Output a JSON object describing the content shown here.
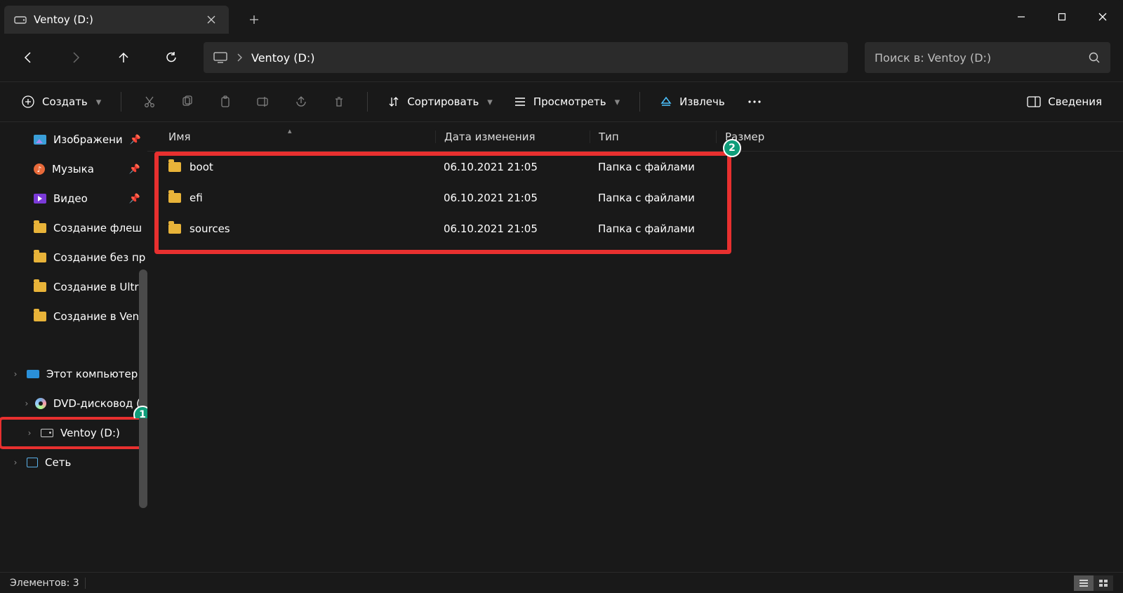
{
  "window": {
    "tab_title": "Ventoy (D:)"
  },
  "address": {
    "location": "Ventoy (D:)"
  },
  "search": {
    "placeholder": "Поиск в: Ventoy (D:)"
  },
  "toolbar": {
    "create": "Создать",
    "sort": "Сортировать",
    "view": "Просмотреть",
    "eject": "Извлечь",
    "details": "Сведения"
  },
  "columns": {
    "name": "Имя",
    "date": "Дата изменения",
    "type": "Тип",
    "size": "Размер"
  },
  "sidebar": {
    "items": [
      {
        "label": "Изображени",
        "kind": "pictures",
        "pinned": true
      },
      {
        "label": "Музыка",
        "kind": "music",
        "pinned": true
      },
      {
        "label": "Видео",
        "kind": "video",
        "pinned": true
      },
      {
        "label": "Создание флеш",
        "kind": "folder"
      },
      {
        "label": "Создание без пр",
        "kind": "folder"
      },
      {
        "label": "Создание в Ultra",
        "kind": "folder"
      },
      {
        "label": "Создание в Ven",
        "kind": "folder"
      }
    ],
    "tree": [
      {
        "label": "Этот компьютер",
        "kind": "pc"
      },
      {
        "label": "DVD-дисковод (",
        "kind": "dvd"
      },
      {
        "label": "Ventoy (D:)",
        "kind": "drive",
        "selected": true
      },
      {
        "label": "Сеть",
        "kind": "net"
      }
    ]
  },
  "files": [
    {
      "name": "boot",
      "date": "06.10.2021 21:05",
      "type": "Папка с файлами",
      "size": ""
    },
    {
      "name": "efi",
      "date": "06.10.2021 21:05",
      "type": "Папка с файлами",
      "size": ""
    },
    {
      "name": "sources",
      "date": "06.10.2021 21:05",
      "type": "Папка с файлами",
      "size": ""
    }
  ],
  "status": {
    "count_label": "Элементов: 3"
  },
  "annotations": {
    "badge1": "1",
    "badge2": "2"
  }
}
